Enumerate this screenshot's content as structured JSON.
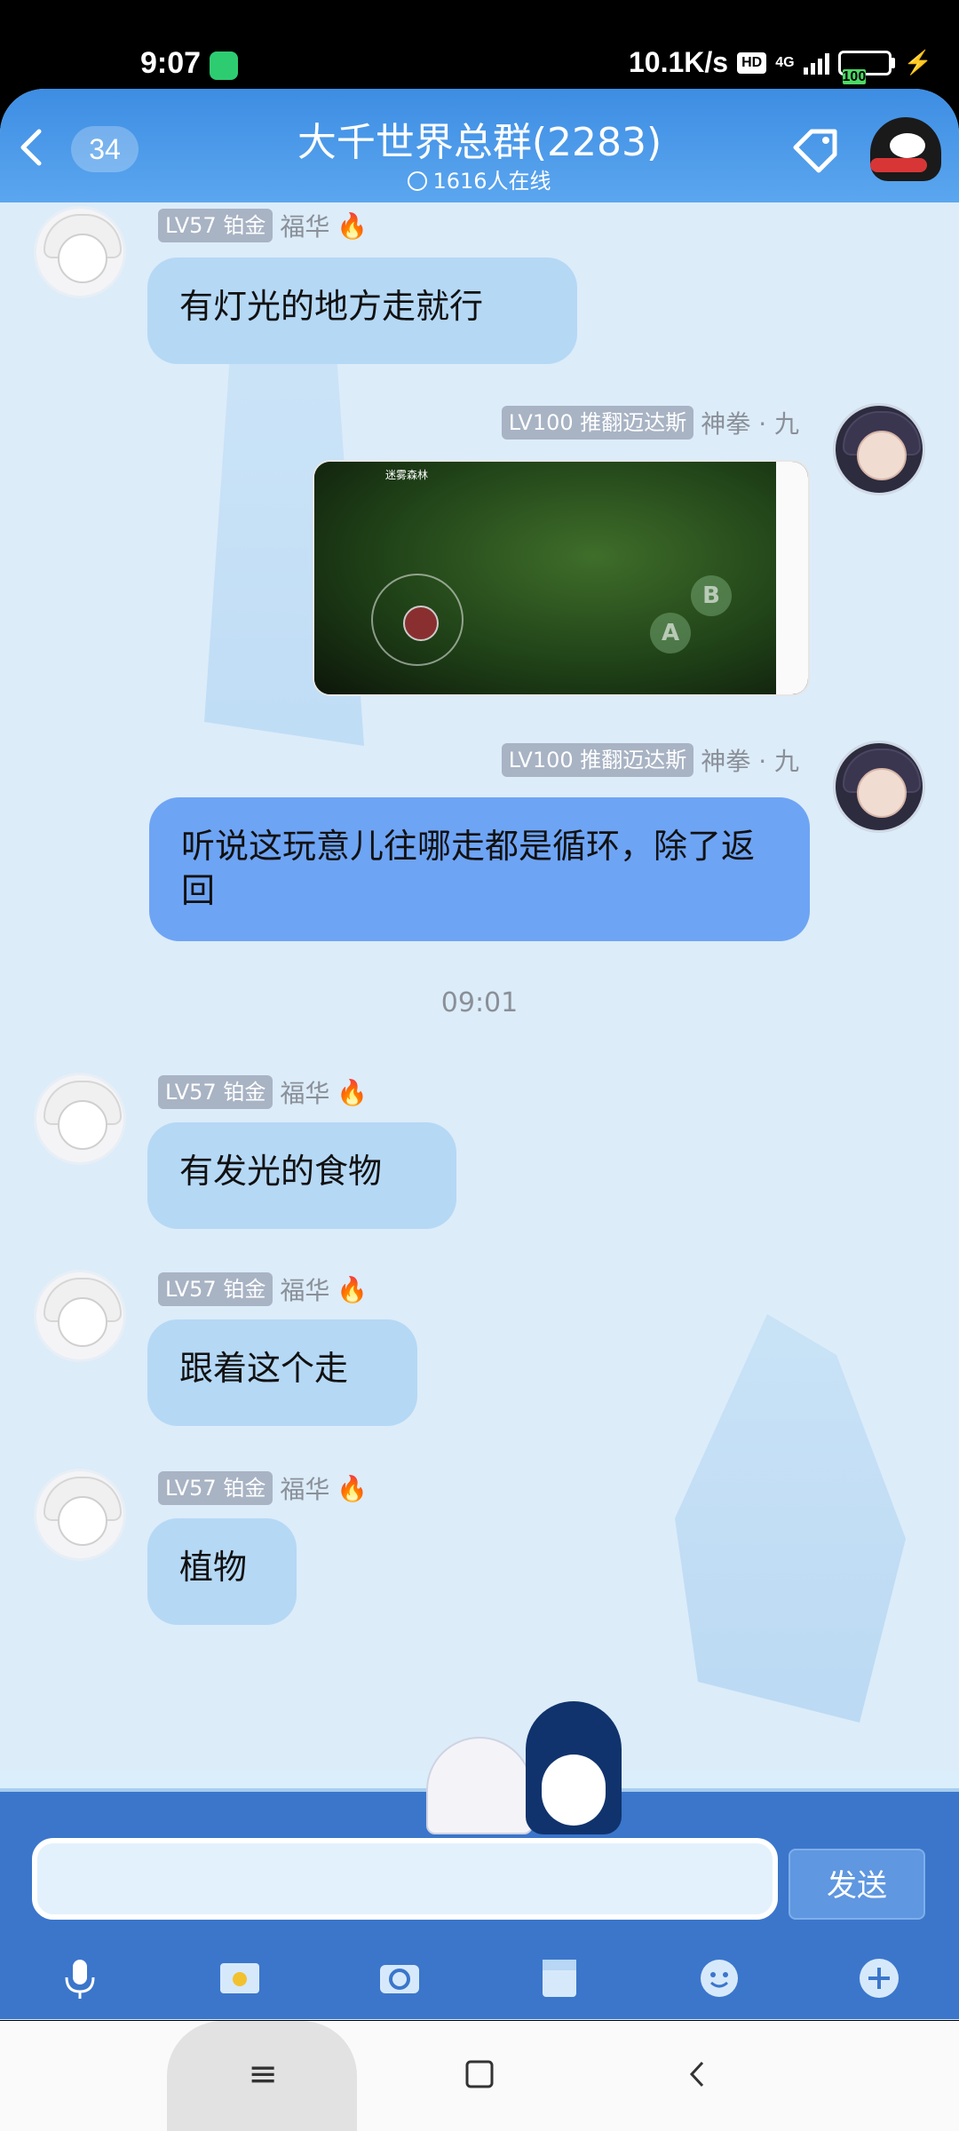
{
  "status": {
    "time": "9:07",
    "speed": "10.1K/s",
    "hd": "HD",
    "network": "4G",
    "battery": "100"
  },
  "header": {
    "unread_count": "34",
    "group_name": "大千世界总群(2283)",
    "online": "1616人在线"
  },
  "messages": [
    {
      "level": "LV57",
      "rank": "铂金",
      "name": "福华",
      "text": "有灯光的地方走就行"
    },
    {
      "level": "LV100",
      "rank": "推翻迈达斯",
      "name": "神拳 · 九",
      "image_label": "迷雾森林",
      "image_btn_a": "A",
      "image_btn_b": "B"
    },
    {
      "level": "LV100",
      "rank": "推翻迈达斯",
      "name": "神拳 · 九",
      "text": "听说这玩意儿往哪走都是循环，除了返回"
    },
    {
      "level": "LV57",
      "rank": "铂金",
      "name": "福华",
      "text": "有发光的食物"
    },
    {
      "level": "LV57",
      "rank": "铂金",
      "name": "福华",
      "text": "跟着这个走"
    },
    {
      "level": "LV57",
      "rank": "铂金",
      "name": "福华",
      "text": "植物"
    }
  ],
  "timestamp": "09:01",
  "input": {
    "value": "",
    "send_label": "发送"
  },
  "toolbar": [
    "mic-icon",
    "image-icon",
    "camera-icon",
    "file-icon",
    "emoji-icon",
    "plus-icon"
  ],
  "colors": {
    "header": "#4a98e8",
    "bubble_other": "#b5d8f5",
    "bubble_self": "#6ea4f4",
    "background": "#dcecf9",
    "input_bar": "#3b76cb"
  }
}
